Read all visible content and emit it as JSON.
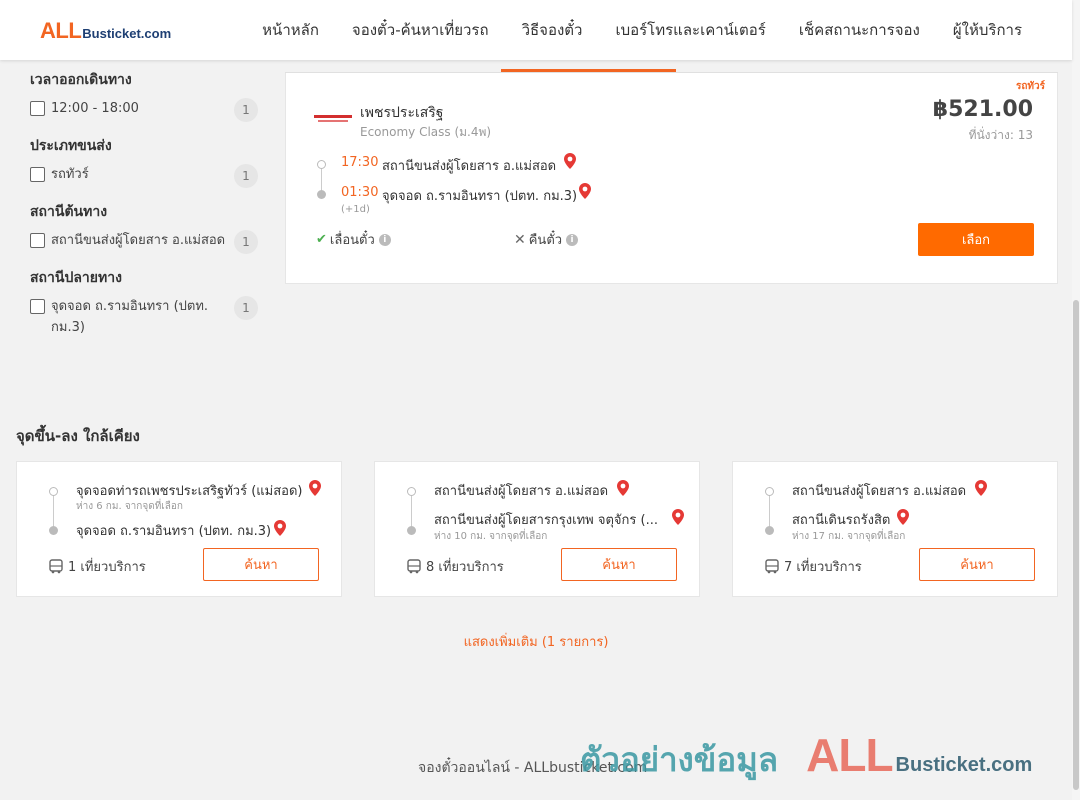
{
  "header": {
    "logo_all": "ALL",
    "logo_rest": "Busticket.com",
    "nav": [
      "หน้าหลัก",
      "จองตั๋ว-ค้นหาเที่ยวรถ",
      "วิธีจองตั๋ว",
      "เบอร์โทรและเคาน์เตอร์",
      "เช็คสถานะการจอง",
      "ผู้ให้บริการ"
    ]
  },
  "filters": {
    "departure_time": {
      "title": "เวลาออกเดินทาง",
      "items": [
        {
          "label": "12:00 - 18:00",
          "count": "1"
        }
      ]
    },
    "transport_type": {
      "title": "ประเภทขนส่ง",
      "items": [
        {
          "label": "รถทัวร์",
          "count": "1"
        }
      ]
    },
    "origin": {
      "title": "สถานีต้นทาง",
      "items": [
        {
          "label": "สถานีขนส่งผู้โดยสาร อ.แม่สอด",
          "count": "1"
        }
      ]
    },
    "destination": {
      "title": "สถานีปลายทาง",
      "items": [
        {
          "label": "จุดจอด ถ.รามอินทรา (ปตท. กม.3)",
          "count": "1"
        }
      ]
    }
  },
  "trip": {
    "tag": "รถทัวร์",
    "operator": "เพชรประเสริฐ",
    "class": "Economy Class (ม.4พ)",
    "price": "฿521.00",
    "seats": "ที่นั่งว่าง: 13",
    "depart_time": "17:30",
    "depart_station": "สถานีขนส่งผู้โดยสาร อ.แม่สอด",
    "arrive_time": "01:30",
    "arrive_station": "จุดจอด ถ.รามอินทรา (ปตท. กม.3)",
    "plus_day": "(+1d)",
    "reschedule": "เลื่อนตั๋ว",
    "refund": "คืนตั๋ว",
    "select_label": "เลือก"
  },
  "nearby": {
    "title": "จุดขึ้น-ลง ใกล้เคียง",
    "cards": [
      {
        "from": "จุดจอดท่ารถเพชรประเสริฐทัวร์ (แม่สอด)",
        "from_dist": "ห่าง 6 กม. จากจุดที่เลือก",
        "to": "จุดจอด ถ.รามอินทรา (ปตท. กม.3)",
        "to_dist": "",
        "services": "1 เที่ยวบริการ",
        "button": "ค้นหา"
      },
      {
        "from": "สถานีขนส่งผู้โดยสาร อ.แม่สอด",
        "from_dist": "",
        "to": "สถานีขนส่งผู้โดยสารกรุงเทพ จตุจักร (...",
        "to_dist": "ห่าง 10 กม. จากจุดที่เลือก",
        "services": "8 เที่ยวบริการ",
        "button": "ค้นหา"
      },
      {
        "from": "สถานีขนส่งผู้โดยสาร อ.แม่สอด",
        "from_dist": "",
        "to": "สถานีเดินรถรังสิต",
        "to_dist": "ห่าง 17 กม. จากจุดที่เลือก",
        "services": "7 เที่ยวบริการ",
        "button": "ค้นหา"
      }
    ],
    "show_more": "แสดงเพิ่มเติม (1 รายการ)"
  },
  "footer": {
    "text": "จองตั๋วออนไลน์ - ALLbusticket.com",
    "watermark_thai": "ตัวอย่างข้อมูล",
    "watermark_all": "ALL",
    "watermark_rest": "Busticket.com"
  },
  "colors": {
    "accent": "#f26522",
    "button": "#ff6a00",
    "pin": "#e53935",
    "brand_blue": "#1e3f73"
  }
}
